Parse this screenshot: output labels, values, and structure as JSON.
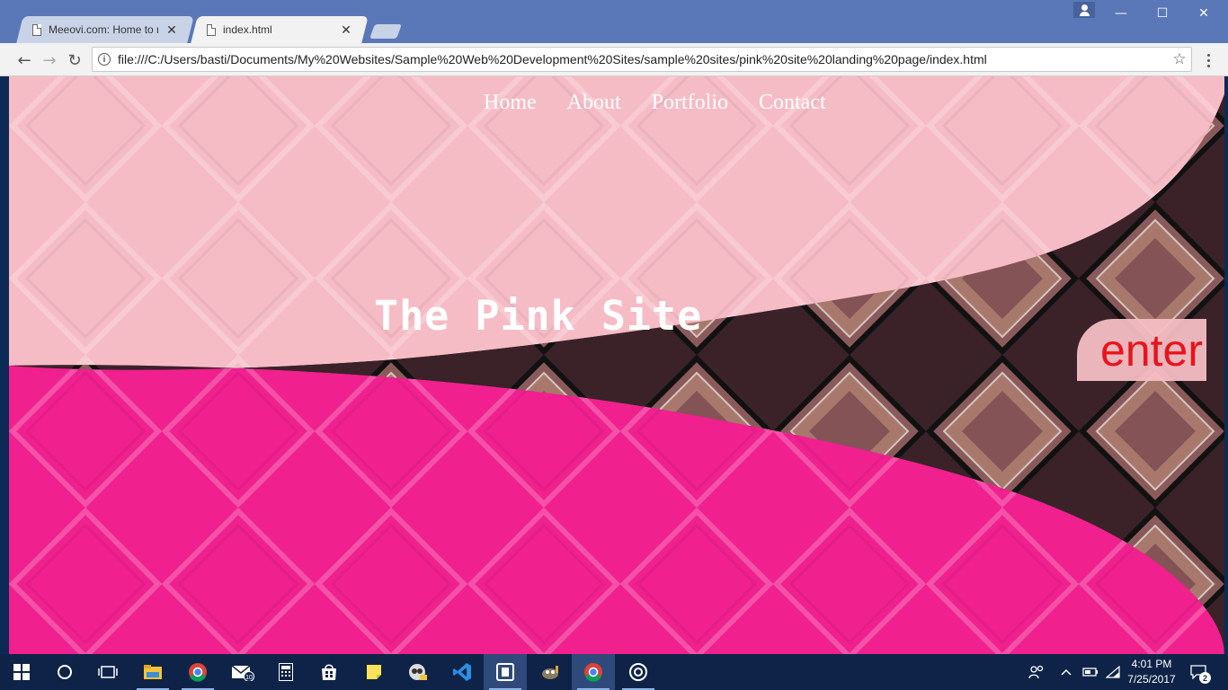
{
  "browser": {
    "tabs": [
      {
        "title": "Meeovi.com: Home to m",
        "close": "✕"
      },
      {
        "title": "index.html",
        "close": "✕"
      }
    ],
    "url": "file:///C:/Users/basti/Documents/My%20Websites/Sample%20Web%20Development%20Sites/sample%20sites/pink%20site%20landing%20page/index.html",
    "controls": {
      "minimize": "—",
      "maximize": "☐",
      "close": "✕"
    },
    "nav": {
      "back": "←",
      "forward": "→",
      "reload": "↻",
      "bookmark": "☆"
    }
  },
  "site": {
    "nav": [
      {
        "label": "Home"
      },
      {
        "label": "About"
      },
      {
        "label": "Portfolio"
      },
      {
        "label": "Contact"
      }
    ],
    "title": "The Pink Site",
    "enter_label": "enter",
    "colors": {
      "light_pink": "#f6bcc6",
      "hot_pink": "#f0208e",
      "enter_text": "#e8141b"
    }
  },
  "taskbar": {
    "icons": [
      "windows-start-icon",
      "cortana-search-icon",
      "task-view-icon",
      "file-explorer-icon",
      "chrome-icon",
      "mail-icon",
      "calculator-icon",
      "store-icon",
      "sticky-notes-icon",
      "app-icon",
      "visual-studio-code-icon",
      "app-icon-2",
      "gimp-icon",
      "chrome-icon-2",
      "groove-icon"
    ],
    "mail_badge": "10",
    "time": "4:01 PM",
    "date": "7/25/2017",
    "notifications": "2"
  }
}
